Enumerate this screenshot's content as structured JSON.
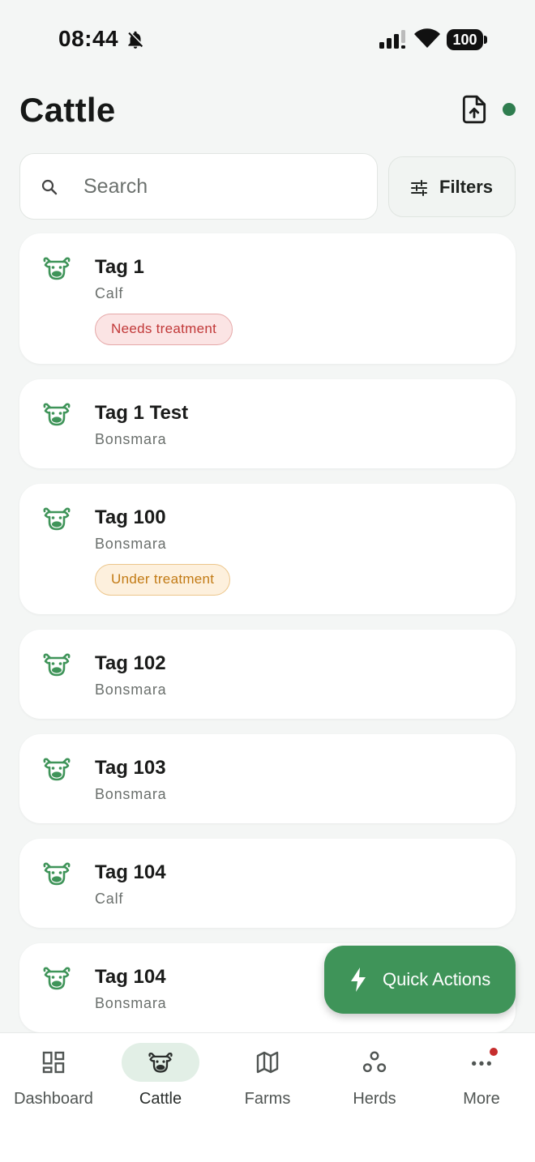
{
  "status_bar": {
    "time": "08:44",
    "battery": "100"
  },
  "header": {
    "title": "Cattle",
    "export_icon": "file-upload-icon",
    "status_dot_color": "#2f7d4f"
  },
  "search": {
    "placeholder": "Search",
    "value": ""
  },
  "filters": {
    "label": "Filters"
  },
  "cattle": [
    {
      "tag": "Tag 1",
      "breed": "Calf",
      "badge": "Needs treatment",
      "badge_type": "red"
    },
    {
      "tag": "Tag 1 Test",
      "breed": "Bonsmara"
    },
    {
      "tag": "Tag 100",
      "breed": "Bonsmara",
      "badge": "Under treatment",
      "badge_type": "orange"
    },
    {
      "tag": "Tag 102",
      "breed": "Bonsmara"
    },
    {
      "tag": "Tag 103",
      "breed": "Bonsmara"
    },
    {
      "tag": "Tag 104",
      "breed": "Calf"
    },
    {
      "tag": "Tag 104",
      "breed": "Bonsmara"
    }
  ],
  "fab": {
    "label": "Quick Actions",
    "icon": "bolt-icon"
  },
  "bottom_nav": [
    {
      "label": "Dashboard",
      "icon": "dashboard-icon"
    },
    {
      "label": "Cattle",
      "icon": "cow-icon",
      "active": true
    },
    {
      "label": "Farms",
      "icon": "map-icon"
    },
    {
      "label": "Herds",
      "icon": "herds-icon"
    },
    {
      "label": "More",
      "icon": "more-dots-icon",
      "notification": true
    }
  ],
  "colors": {
    "accent_green": "#3f9459",
    "badge_red": "#c13838",
    "badge_orange": "#c27a14"
  }
}
